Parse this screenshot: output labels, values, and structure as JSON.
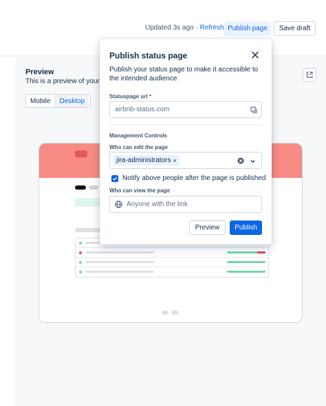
{
  "header": {
    "updated_text": "Updated 3s ago",
    "separator": "·",
    "refresh_label": "Refresh",
    "publish_page_label": "Publish page",
    "save_draft_label": "Save draft"
  },
  "preview": {
    "title": "Preview",
    "description": "This is a preview of your p",
    "tabs": [
      {
        "label": "Mobile"
      },
      {
        "label": "Desktop"
      }
    ],
    "active_tab": "Desktop"
  },
  "modal": {
    "title": "Publish status page",
    "description": "Publish your status page to make it accessible to the intended audience",
    "url_label": "Statuspage url",
    "url_required_mark": "*",
    "url_placeholder": "airbnb-status.com",
    "section_title": "Management Controls",
    "edit_label": "Who can edit the page",
    "edit_tag": "jira-administrators",
    "notify_label": "Notify above people after the page is published",
    "notify_checked": true,
    "view_label": "Who can view the page",
    "view_placeholder": "Anyone with the link",
    "preview_button": "Preview",
    "publish_button": "Publish"
  },
  "icons": {
    "close": "close-icon",
    "copy": "copy-icon",
    "clear": "clear-icon",
    "chevron": "chevron-down-icon",
    "globe": "globe-icon",
    "external": "external-link-icon"
  },
  "colors": {
    "accent": "#0c66e4",
    "banner": "#f88b84",
    "top_accent": "#5b3fd0"
  }
}
